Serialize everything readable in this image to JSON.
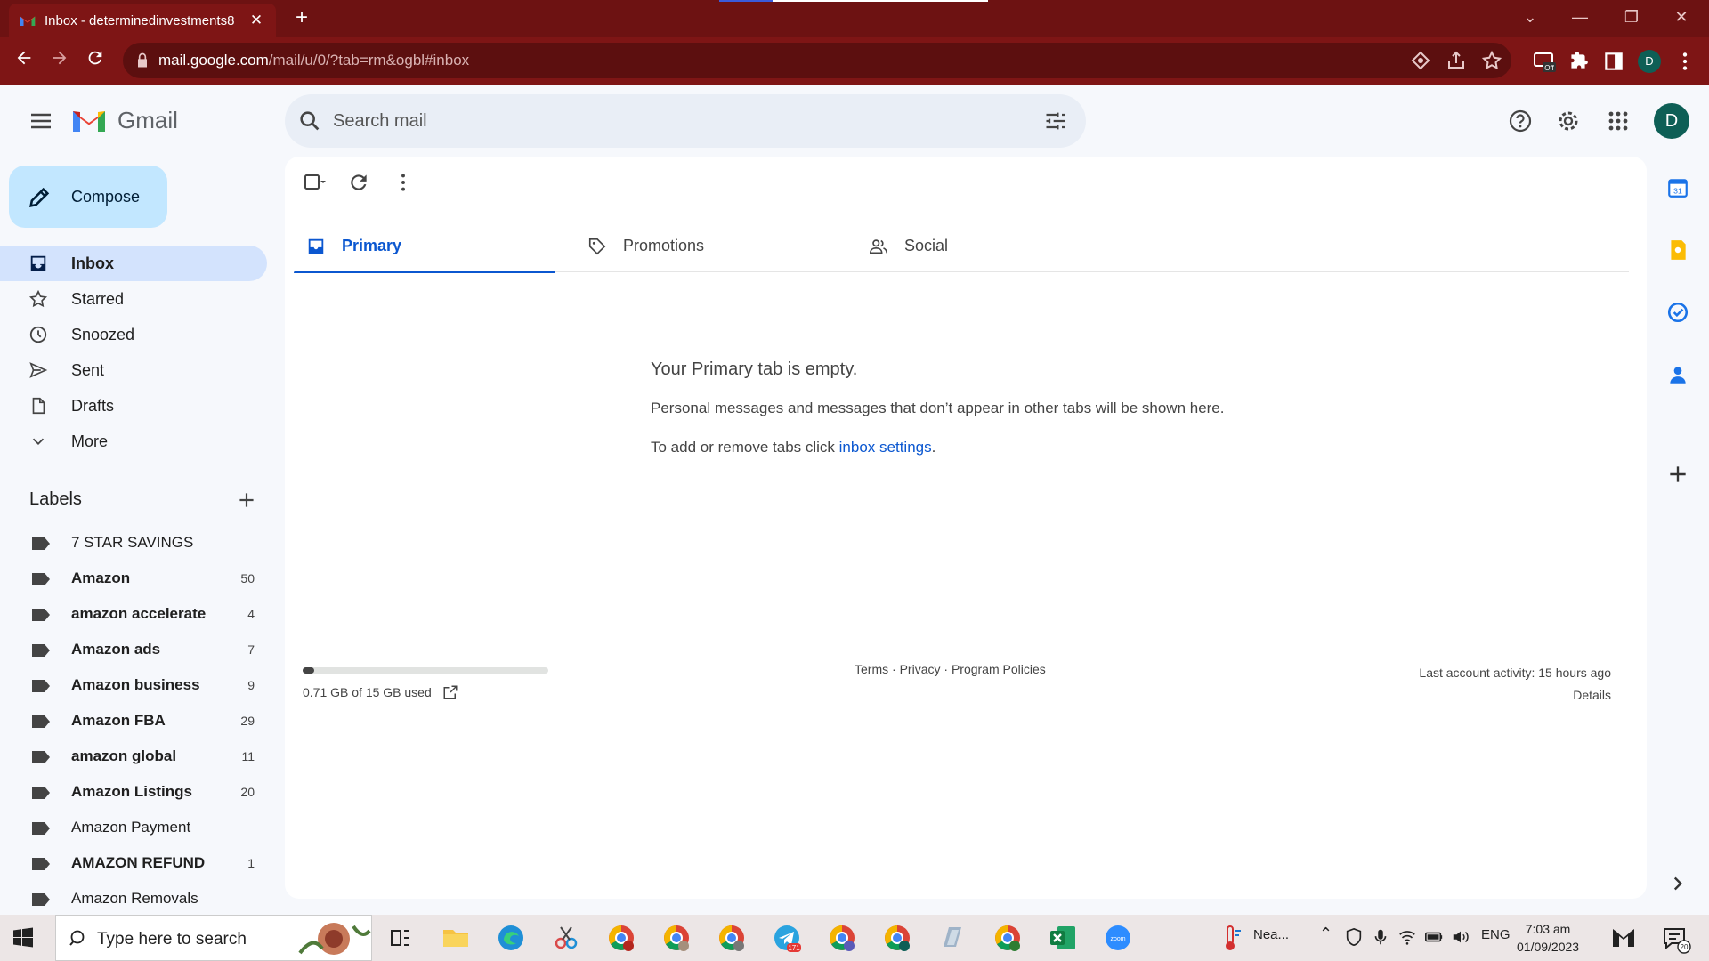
{
  "browser": {
    "tab_title": "Inbox - determinedinvestments8",
    "url_host": "mail.google.com",
    "url_path": "/mail/u/0/?tab=rm&ogbl#inbox",
    "profile_initial": "D",
    "extension_badge": "Off"
  },
  "gmail": {
    "logo_text": "Gmail",
    "search_placeholder": "Search mail",
    "avatar_initial": "D",
    "compose_label": "Compose",
    "nav": [
      {
        "label": "Inbox",
        "icon": "inbox-icon",
        "active": true
      },
      {
        "label": "Starred",
        "icon": "star-icon"
      },
      {
        "label": "Snoozed",
        "icon": "clock-icon"
      },
      {
        "label": "Sent",
        "icon": "send-icon"
      },
      {
        "label": "Drafts",
        "icon": "draft-icon"
      },
      {
        "label": "More",
        "icon": "chevron-down-icon"
      }
    ],
    "labels_heading": "Labels",
    "labels": [
      {
        "name": "7 STAR SAVINGS",
        "count": "",
        "bold": false
      },
      {
        "name": "Amazon",
        "count": "50",
        "bold": true
      },
      {
        "name": "amazon accelerate",
        "count": "4",
        "bold": true
      },
      {
        "name": "Amazon ads",
        "count": "7",
        "bold": true
      },
      {
        "name": "Amazon business",
        "count": "9",
        "bold": true
      },
      {
        "name": "Amazon FBA",
        "count": "29",
        "bold": true
      },
      {
        "name": "amazon global",
        "count": "11",
        "bold": true
      },
      {
        "name": "Amazon Listings",
        "count": "20",
        "bold": true
      },
      {
        "name": "Amazon Payment",
        "count": "",
        "bold": false
      },
      {
        "name": "AMAZON REFUND",
        "count": "1",
        "bold": true
      },
      {
        "name": "Amazon Removals",
        "count": "",
        "bold": false
      }
    ],
    "tabs": [
      {
        "label": "Primary",
        "icon": "inbox-tab-icon",
        "active": true
      },
      {
        "label": "Promotions",
        "icon": "tag-icon"
      },
      {
        "label": "Social",
        "icon": "people-icon"
      }
    ],
    "empty": {
      "heading": "Your Primary tab is empty.",
      "line1": "Personal messages and messages that don’t appear in other tabs will be shown here.",
      "line2_prefix": "To add or remove tabs click ",
      "line2_link": "inbox settings",
      "line2_suffix": "."
    },
    "storage": {
      "text": "0.71 GB of 15 GB used",
      "fraction": 0.047
    },
    "footer": {
      "terms": "Terms",
      "privacy": "Privacy",
      "policies": "Program Policies",
      "sep": " · "
    },
    "activity": {
      "text": "Last account activity: 15 hours ago",
      "details": "Details"
    }
  },
  "taskbar": {
    "search_text": "Type here to search",
    "weather": "Nea...",
    "language": "ENG",
    "time": "7:03 am",
    "date": "01/09/2023",
    "notifications": "20",
    "badge_171": "171"
  },
  "colors": {
    "chrome_frame": "#6d1212",
    "chrome_toolbar": "#7e1515",
    "accent_blue": "#0b57d0",
    "compose_bg": "#c2e7ff",
    "nav_active_bg": "#d3e3fd"
  }
}
